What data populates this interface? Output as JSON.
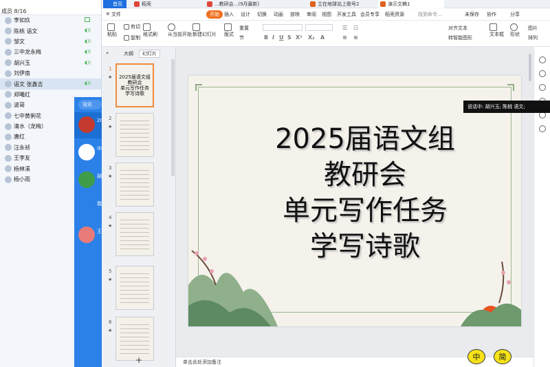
{
  "members": {
    "header": "成员 8/16",
    "list": [
      {
        "name": "李如玖",
        "status": "cam"
      },
      {
        "name": "陈桃 语文",
        "status": "mic"
      },
      {
        "name": "邹文",
        "status": "mic"
      },
      {
        "name": "三中龙永梅",
        "status": "mic"
      },
      {
        "name": "胡兴玉",
        "status": "mic"
      },
      {
        "name": "刘伊南",
        "status": "none"
      },
      {
        "name": "语文 张鑫吉",
        "status": "mic"
      },
      {
        "name": "郑曦红",
        "status": "none"
      },
      {
        "name": "波哥",
        "status": "none"
      },
      {
        "name": "七中黄俐花",
        "status": "none"
      },
      {
        "name": "清水（龙梅）",
        "status": "none"
      },
      {
        "name": "唐红",
        "status": "none"
      },
      {
        "name": "汪永祯",
        "status": "none"
      },
      {
        "name": "王李友",
        "status": "none"
      },
      {
        "name": "杨林溪",
        "status": "none"
      },
      {
        "name": "杨小雨",
        "status": "none"
      }
    ]
  },
  "chat": {
    "search_placeholder": "搜索",
    "rows": [
      {
        "text": "20"
      },
      {
        "text": "中"
      },
      {
        "text": "胡"
      },
      {
        "text": "我"
      },
      {
        "text": "王"
      }
    ]
  },
  "wps": {
    "tabs": [
      {
        "label": "首页",
        "color": "#1f6fe0"
      },
      {
        "label": "稻壳",
        "color": "#e0473c"
      },
      {
        "label": "...教研会...(9月最新)",
        "color": "#e0473c"
      },
      {
        "label": "立在地球站上歌号2",
        "color": "#e0601a"
      },
      {
        "label": "演示文稿1",
        "color": "#e0601a"
      }
    ],
    "ribbon_tabs": [
      "文件",
      "开始",
      "插入",
      "设计",
      "切换",
      "动画",
      "放映",
      "审阅",
      "视图",
      "开发工具",
      "会员专享",
      "稻壳资源"
    ],
    "active_ribbon_tab": "开始",
    "search_placeholder": "找到命令...",
    "right_actions": [
      "未保存",
      "协作",
      "分享"
    ],
    "toolbar": {
      "paste": "粘贴",
      "cut": "剪切",
      "copy": "复制",
      "format_painter": "格式刷",
      "from_start": "从当前开始",
      "new_slide": "新建幻灯片",
      "layout": "版式",
      "section": "节",
      "reset": "重置",
      "align": "对齐文本",
      "convert_smartart": "转智能图形",
      "textbox": "文本框",
      "shape": "形状",
      "picture": "图片",
      "arrange": "排列"
    },
    "thumb_tabs": [
      "大纲",
      "幻灯片"
    ],
    "active_thumb_tab": "幻灯片",
    "slides": [
      {
        "num": "1",
        "title": "2025届语文组\n教研会\n单元写作任务\n学写诗歌",
        "selected": true
      },
      {
        "num": "2",
        "selected": false
      },
      {
        "num": "3",
        "selected": false
      },
      {
        "num": "4",
        "selected": false
      },
      {
        "num": "5",
        "selected": false
      },
      {
        "num": "6",
        "selected": false
      }
    ],
    "slide_title": "2025届语文组\n教研会\n单元写作任务\n学写诗歌",
    "notes_placeholder": "单击此处添加备注",
    "speaking": "说话中: 胡兴玉; 陈桃 语文;",
    "ime": [
      "中",
      "简"
    ]
  }
}
